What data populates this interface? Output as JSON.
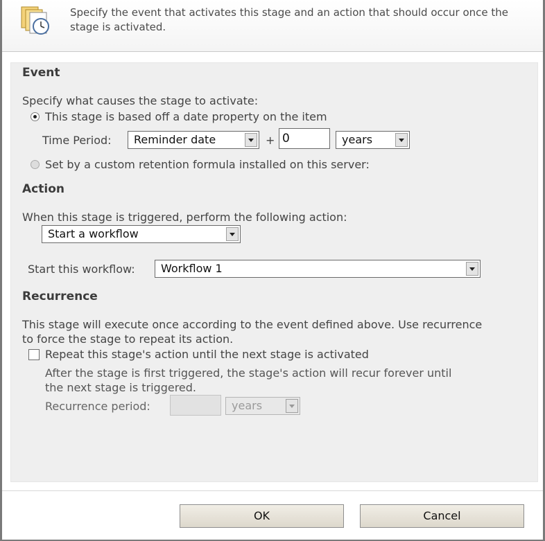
{
  "header": {
    "icon": "stage-clock-icon",
    "description": "Specify the event that activates this stage and an action that should occur once the stage is activated."
  },
  "event": {
    "title": "Event",
    "instruction": "Specify what causes the stage to activate:",
    "option_date": "This stage is based off a date property on the item",
    "time_period_label": "Time Period:",
    "date_property": "Reminder date",
    "plus": "+",
    "amount": "0",
    "unit": "years",
    "option_custom": "Set by a custom retention formula installed on this server:"
  },
  "action": {
    "title": "Action",
    "instruction": "When this stage is triggered, perform the following action:",
    "selected_action": "Start a workflow",
    "workflow_label": "Start this workflow:",
    "workflow_value": "Workflow 1"
  },
  "recurrence": {
    "title": "Recurrence",
    "description_line1": "This stage will execute once according to the event defined above. Use recurrence",
    "description_line2": "to force the stage to repeat its action.",
    "repeat_label": "Repeat this stage's action until the next stage is activated",
    "note_line1": "After the stage is first triggered, the stage's action will recur forever until",
    "note_line2": "the next stage is triggered.",
    "period_label": "Recurrence period:",
    "period_value": "",
    "period_unit": "years"
  },
  "footer": {
    "ok_label": "OK",
    "cancel_label": "Cancel"
  }
}
